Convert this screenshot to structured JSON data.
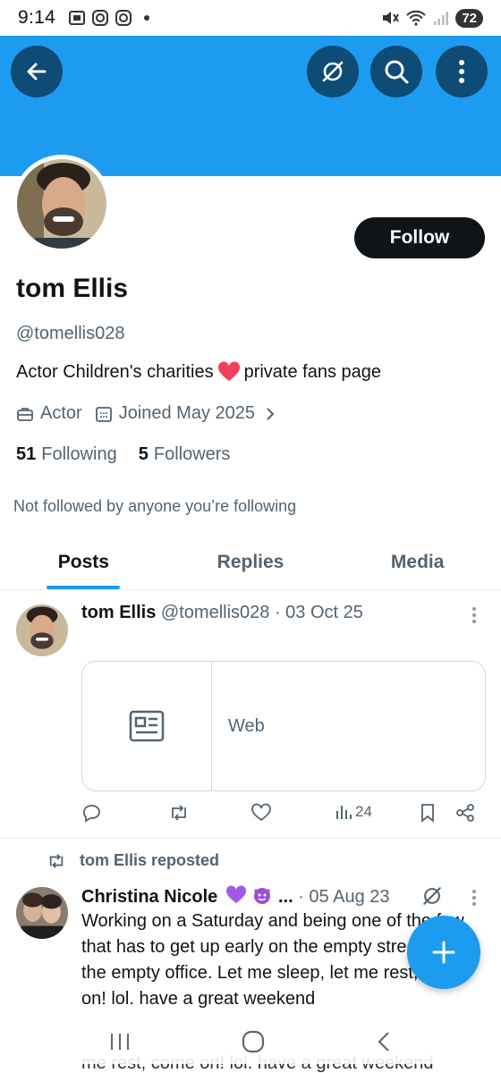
{
  "status_bar": {
    "time": "9:14",
    "battery": "72",
    "left_icons": [
      "gallery-icon",
      "instagram-icon",
      "instagram-icon",
      "notification-dot-icon"
    ],
    "right_icons": [
      "mute-icon",
      "wifi-icon",
      "signal-icon"
    ]
  },
  "header": {
    "banner_color": "#1d9bf0",
    "buttons": [
      "back-arrow-icon",
      "grok-icon",
      "search-icon",
      "more-vertical-icon"
    ]
  },
  "profile": {
    "display_name": "tom Ellis",
    "handle": "@tomellis028",
    "bio_before": "Actor  Children's charities",
    "bio_after": "private fans page",
    "category": "Actor",
    "joined": "Joined May 2025",
    "following_count": "51",
    "following_label": "Following",
    "followers_count": "5",
    "followers_label": "Followers",
    "not_followed_text": "Not followed by anyone you’re following",
    "follow_label": "Follow"
  },
  "tabs": [
    {
      "label": "Posts",
      "active": true
    },
    {
      "label": "Replies",
      "active": false
    },
    {
      "label": "Media",
      "active": false
    }
  ],
  "posts": [
    {
      "author": "tom Ellis",
      "meta": "@tomellis028 · 03 Oct 25",
      "card_label": "Web",
      "views": "24"
    },
    {
      "repost_label": "tom Ellis reposted",
      "author": "Christina Nicole",
      "author_suffix": "...",
      "meta": "· 05 Aug 23",
      "text": "Working on a Saturday and being one of the few that has to get up early on the empty streets and the empty office. Let me sleep, let me rest, come on! lol. have a great weekend",
      "ghost_text": "me rest, come on! lol. have a great weekend"
    }
  ],
  "accent_color": "#1d9bf0"
}
